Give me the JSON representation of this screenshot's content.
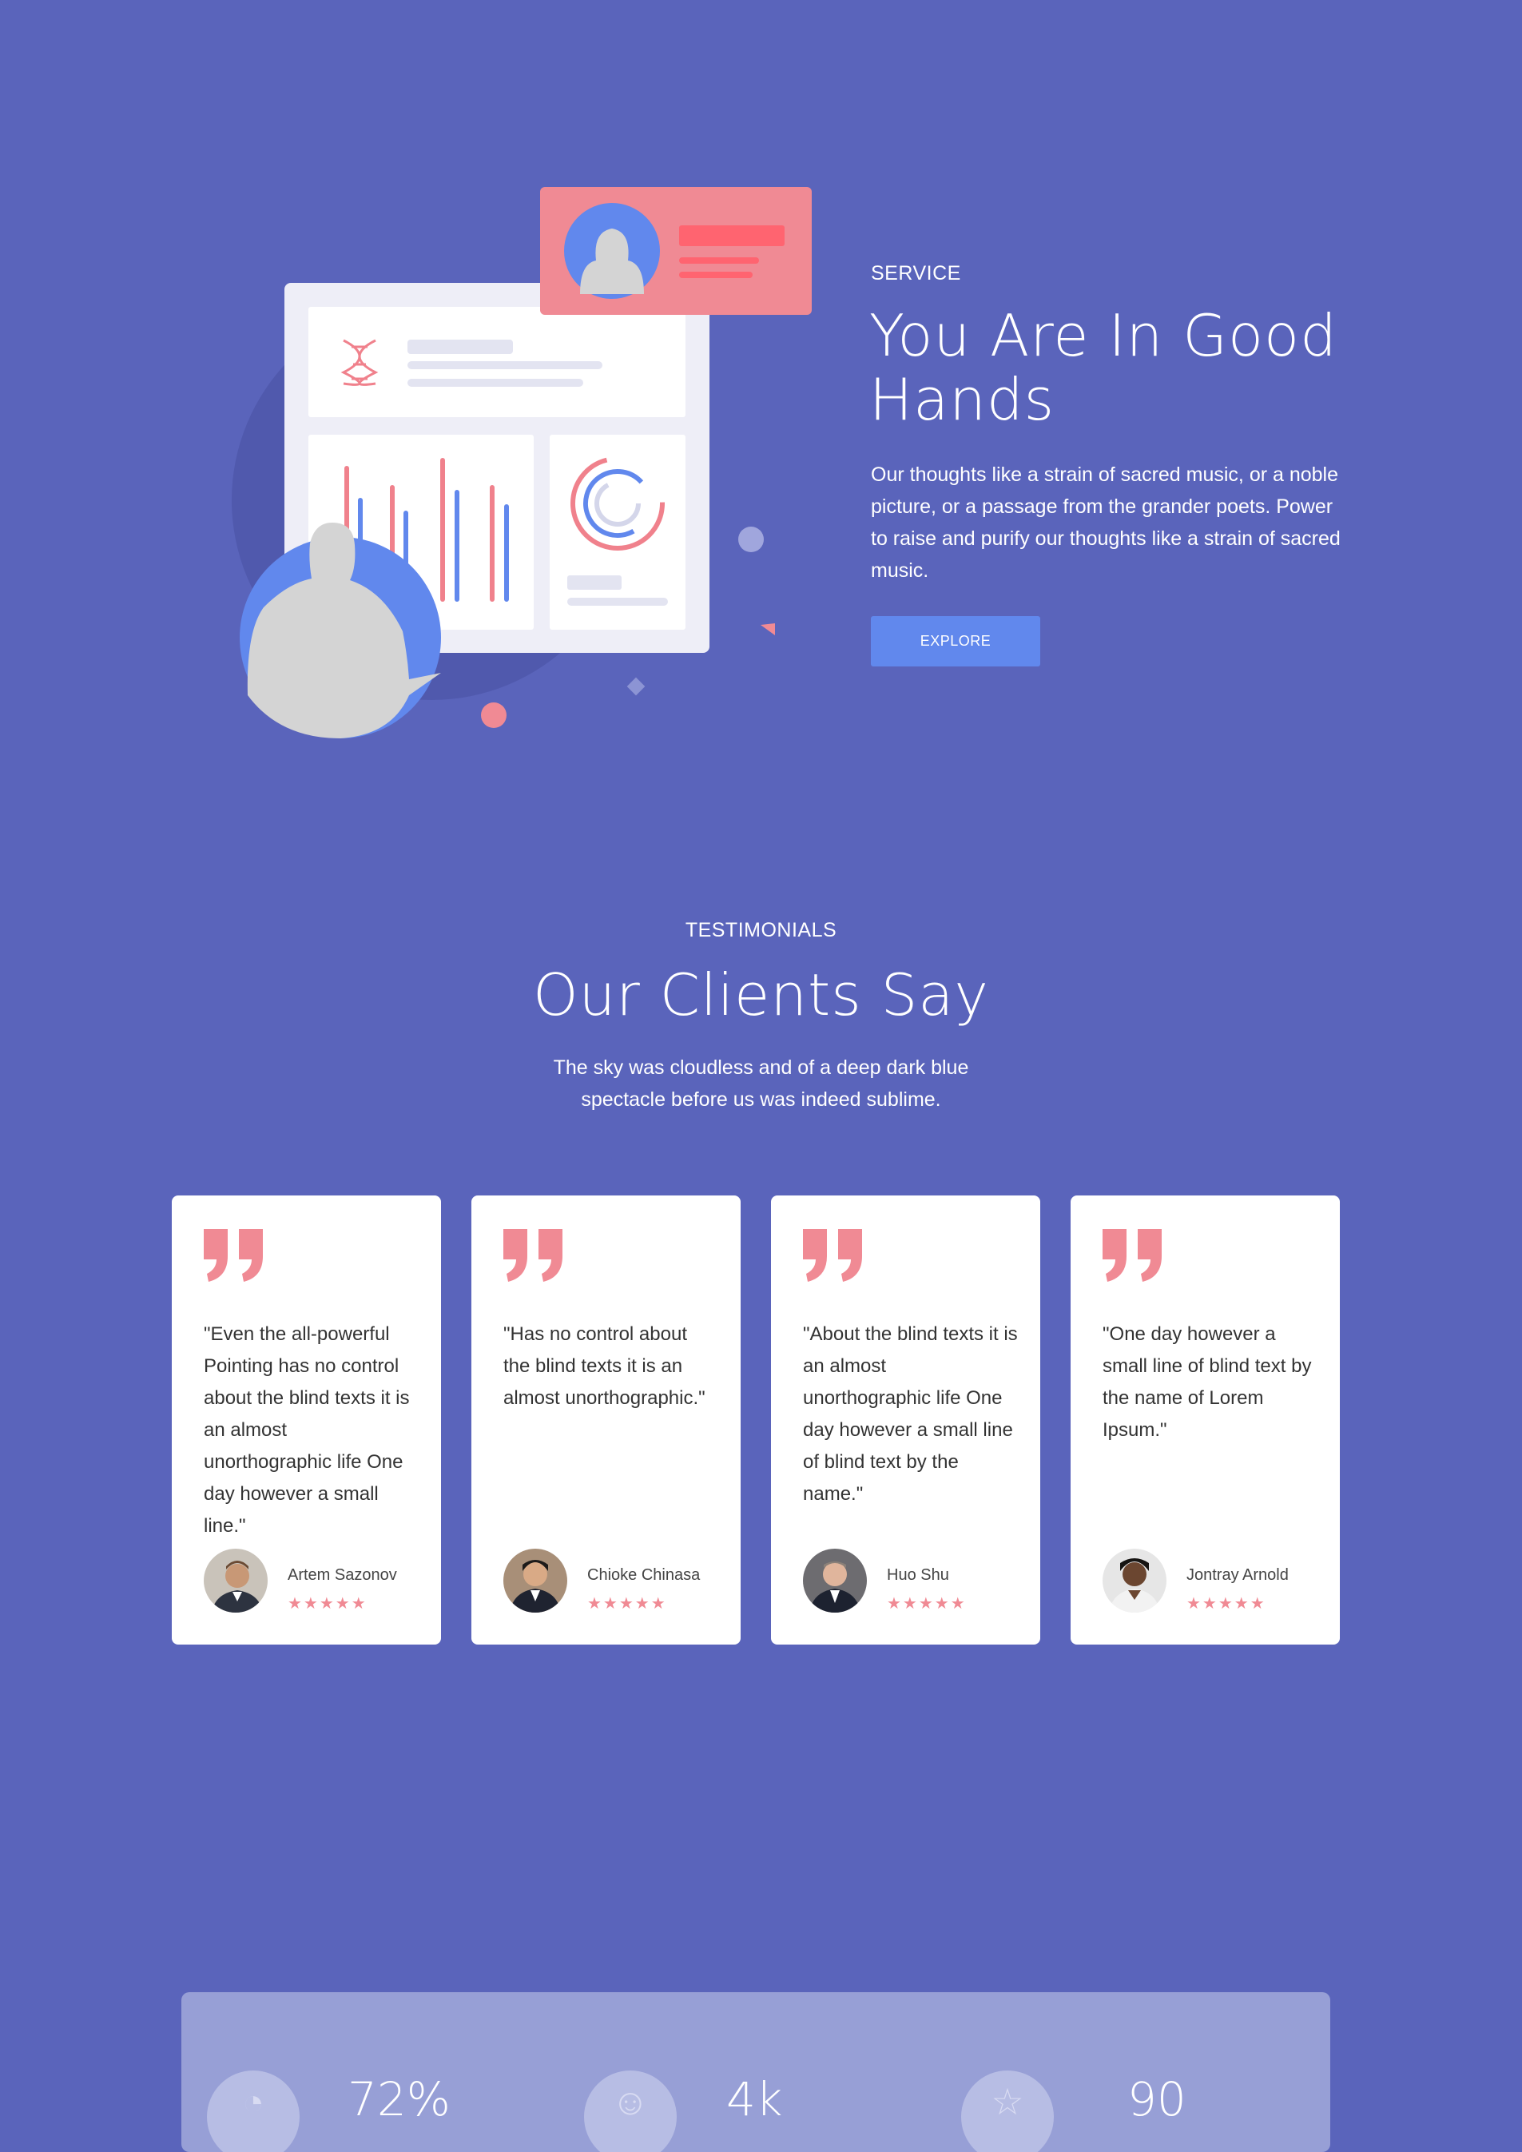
{
  "service": {
    "label": "SERVICE",
    "title": "You Are In Good Hands",
    "text": "Our thoughts like a strain of sacred music, or a noble picture, or a passage from the grander poets. Power to raise and purify our thoughts like a strain of sacred music.",
    "button_label": "EXPLORE"
  },
  "testimonials": {
    "label": "TESTIMONIALS",
    "title": "Our Clients Say",
    "subtitle_line1": "The sky was cloudless and of a deep dark blue",
    "subtitle_line2": "spectacle before us was indeed sublime.",
    "cards": [
      {
        "quote": "\"Even the all-powerful Pointing has no control about the blind texts it is an almost unorthographic life One day however a small line.\"",
        "name": "Artem Sazonov",
        "stars": "★★★★★",
        "icon": "quote-icon"
      },
      {
        "quote": "\"Has no control about the blind texts it is an almost unorthographic.\"",
        "name": "Chioke Chinasa",
        "stars": "★★★★★",
        "icon": "quote-icon"
      },
      {
        "quote": "\"About the blind texts it is an almost unorthographic life One day however a small line of blind text by the name.\"",
        "name": "Huo Shu",
        "stars": "★★★★★",
        "icon": "quote-icon"
      },
      {
        "quote": "\"One day however a small line of blind text by the name of Lorem Ipsum.\"",
        "name": "Jontray Arnold",
        "stars": "★★★★★",
        "icon": "quote-icon"
      }
    ]
  },
  "stats": {
    "items": [
      {
        "value": "72%",
        "icon": "chart-icon"
      },
      {
        "value": "4k",
        "icon": "users-icon"
      },
      {
        "value": "90",
        "icon": "star-icon"
      }
    ]
  },
  "colors": {
    "background": "#5a64bb",
    "accent_blue": "#6188ed",
    "accent_pink": "#f08a94",
    "card_bg": "#ffffff",
    "stats_panel": "#979fd6"
  }
}
